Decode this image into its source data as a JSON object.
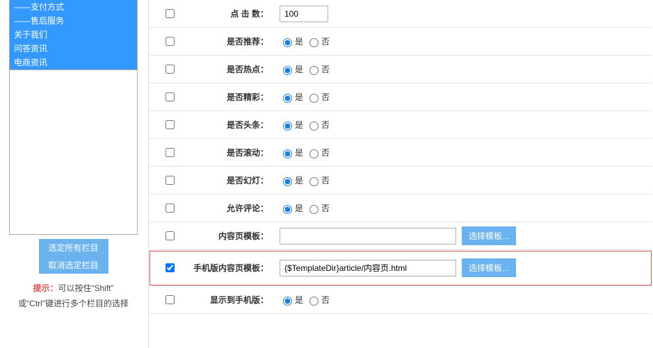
{
  "sidebar": {
    "items": [
      {
        "label": "——支付方式"
      },
      {
        "label": "——售后服务"
      },
      {
        "label": "关于我们"
      },
      {
        "label": "问答资讯"
      },
      {
        "label": "电商资讯"
      }
    ],
    "btn_select_all": "选定所有栏目",
    "btn_deselect": "取消选定栏目",
    "tip_prefix": "提示：",
    "tip_line1": "可以按住“Shift”",
    "tip_line2": "或“Ctrl”键进行多个栏目的选择"
  },
  "form": {
    "rows": [
      {
        "label": "点 击 数：",
        "type": "input_small",
        "value": "100"
      },
      {
        "label": "是否推荐：",
        "type": "radio",
        "checked": "yes"
      },
      {
        "label": "是否热点：",
        "type": "radio",
        "checked": "yes"
      },
      {
        "label": "是否精彩：",
        "type": "radio",
        "checked": "yes"
      },
      {
        "label": "是否头条：",
        "type": "radio",
        "checked": "yes"
      },
      {
        "label": "是否滚动：",
        "type": "radio",
        "checked": "yes"
      },
      {
        "label": "是否幻灯：",
        "type": "radio",
        "checked": "yes"
      },
      {
        "label": "允许评论：",
        "type": "radio",
        "checked": "yes"
      },
      {
        "label": "内容页模板：",
        "type": "template",
        "value": ""
      },
      {
        "label": "手机版内容页模板：",
        "type": "template",
        "value": "{$TemplateDir}article/内容页.html",
        "highlight": true,
        "checked": true
      },
      {
        "label": "显示到手机版：",
        "type": "radio",
        "checked": "yes"
      }
    ],
    "radio_yes": "是",
    "radio_no": "否",
    "choose_template": "选择模板..."
  }
}
